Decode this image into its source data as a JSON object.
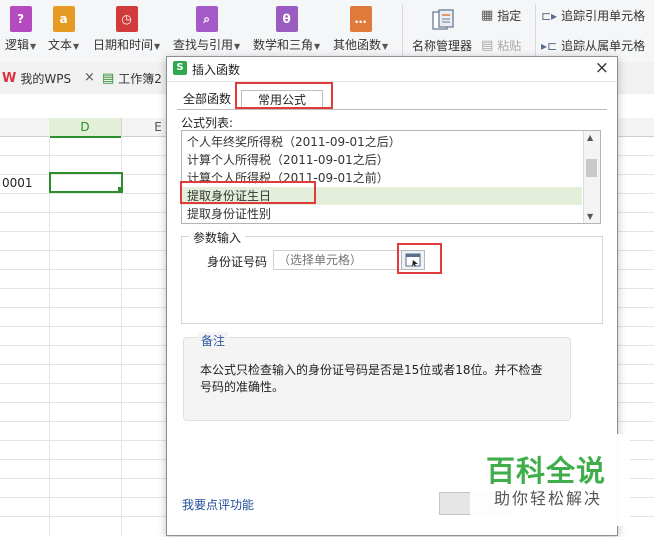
{
  "ribbon": {
    "groups": [
      {
        "label": "逻辑",
        "icon": "?",
        "color": "#b54ac1"
      },
      {
        "label": "文本",
        "icon": "a",
        "color": "#e69a24"
      },
      {
        "label": "日期和时间",
        "icon": "◷",
        "color": "#d23b3b"
      },
      {
        "label": "查找与引用",
        "icon": "⌕",
        "color": "#a55ac8"
      },
      {
        "label": "数学和三角",
        "icon": "θ",
        "color": "#9b5cc2"
      },
      {
        "label": "其他函数",
        "icon": "…",
        "color": "#e07a3b"
      }
    ],
    "name_manager": "名称管理器",
    "specify": "指定",
    "paste": "粘贴",
    "trace_precedents": "追踪引用单元格",
    "trace_dependents": "追踪从属单元格"
  },
  "tabs": {
    "wps": "我的WPS",
    "close_glyph": "×",
    "workbook": "工作簿2"
  },
  "sheet": {
    "columns": [
      "D",
      "E"
    ],
    "cell_text": "0001"
  },
  "dialog": {
    "title": "插入函数",
    "close": "×",
    "tab_all": "全部函数",
    "tab_common": "常用公式",
    "list_label": "公式列表:",
    "formulas": [
      "个人年终奖所得税（2011-09-01之后）",
      "计算个人所得税（2011-09-01之后）",
      "计算个人所得税（2011-09-01之前）",
      "提取身份证生日",
      "提取身份证性别"
    ],
    "selected_index": 3,
    "params_legend": "参数输入",
    "id_label": "身份证号码",
    "id_placeholder": "（选择单元格）",
    "note_title": "备注",
    "note_text": "本公式只检查输入的身份证号码是否是15位或者18位。并不检查号码的准确性。",
    "feedback": "我要点评功能"
  },
  "watermark": {
    "title": "百科全说",
    "subtitle": "助你轻松解决"
  },
  "colors": {
    "highlight": "#e03a3a",
    "selection_green": "#2d8e2d",
    "wps_red": "#d9333f",
    "link_blue": "#1f4e99"
  }
}
